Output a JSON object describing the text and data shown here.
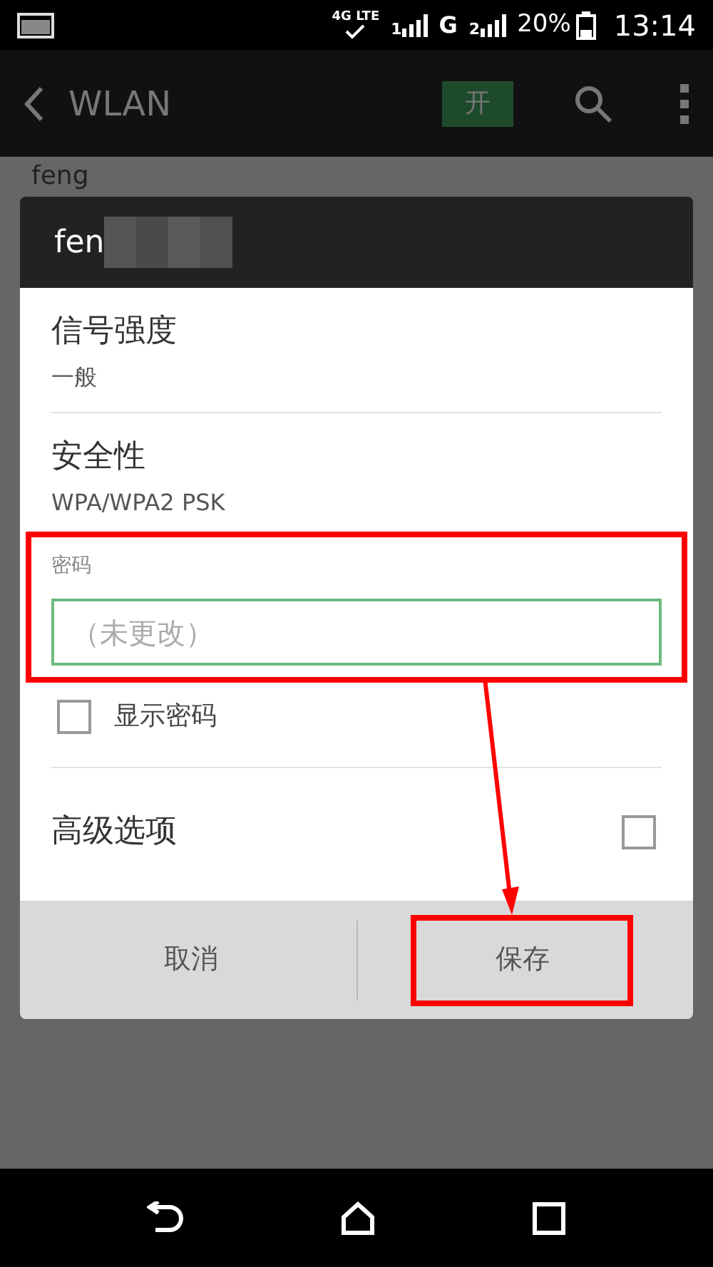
{
  "status_bar": {
    "network": "4G LTE",
    "signal_1": "1",
    "network_2": "G",
    "signal_2": "2",
    "battery": "20%",
    "time": "13:14"
  },
  "action_bar": {
    "title": "WLAN",
    "toggle": {
      "label": "开",
      "on": true
    }
  },
  "background_list": {
    "network_name": "feng"
  },
  "dialog": {
    "title": "fen",
    "rows": [
      {
        "kind": "info",
        "label": "信号强度",
        "value": "一般"
      },
      {
        "kind": "info",
        "label": "安全性",
        "value": "WPA/WPA2 PSK"
      },
      {
        "kind": "password",
        "label": "密码",
        "placeholder": "（未更改）",
        "highlighted": true
      },
      {
        "kind": "check",
        "label": "显示密码",
        "checked": false
      },
      {
        "kind": "option",
        "label": "高级选项",
        "checked": false
      }
    ],
    "buttons": [
      {
        "label": "取消",
        "highlighted": false
      },
      {
        "label": "保存",
        "highlighted": true
      }
    ]
  },
  "annotation_arrow": true
}
